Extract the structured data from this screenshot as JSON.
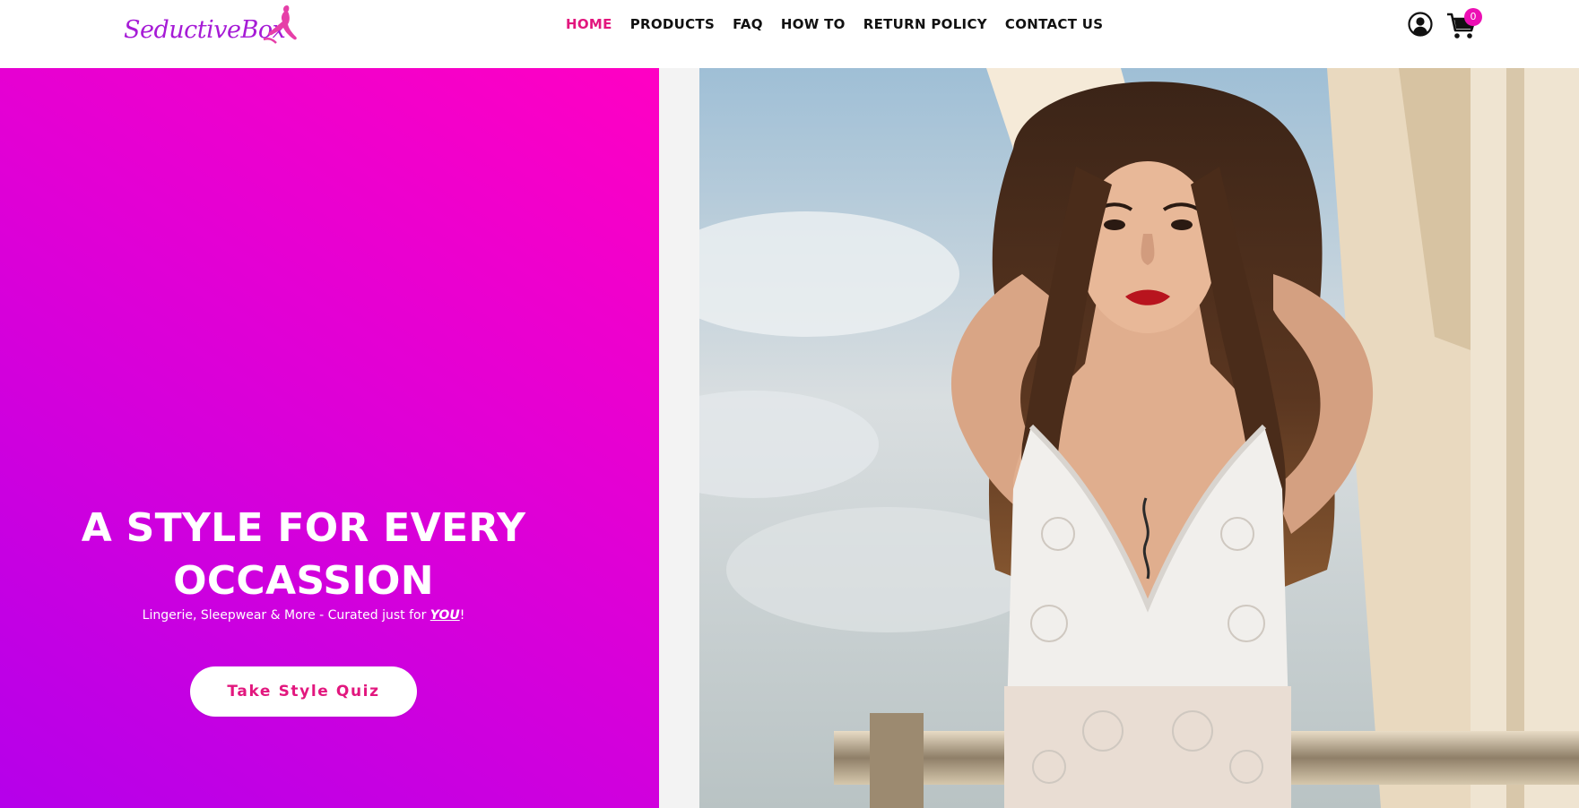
{
  "header": {
    "logo_text": "SeductiveBox",
    "nav": [
      {
        "label": "HOME",
        "active": true
      },
      {
        "label": "PRODUCTS",
        "active": false
      },
      {
        "label": "FAQ",
        "active": false
      },
      {
        "label": "HOW TO",
        "active": false
      },
      {
        "label": "RETURN POLICY",
        "active": false
      },
      {
        "label": "CONTACT US",
        "active": false
      }
    ],
    "account_icon": "user-circle-icon",
    "cart_icon": "shopping-cart-icon",
    "cart_count": "0"
  },
  "hero": {
    "headline_line1": "A STYLE FOR EVERY",
    "headline_line2": "OCCASSION",
    "subtitle_prefix": "Lingerie, Sleepwear & More - Curated just for ",
    "subtitle_emphasis": "YOU",
    "subtitle_suffix": "!",
    "cta_label": "Take Style Quiz"
  },
  "colors": {
    "accent_pink": "#e2177e",
    "badge_pink": "#ec0fb4",
    "gradient_top": "#ff00c3",
    "gradient_bottom": "#b500ea",
    "logo_purple": "#a61bd6"
  }
}
